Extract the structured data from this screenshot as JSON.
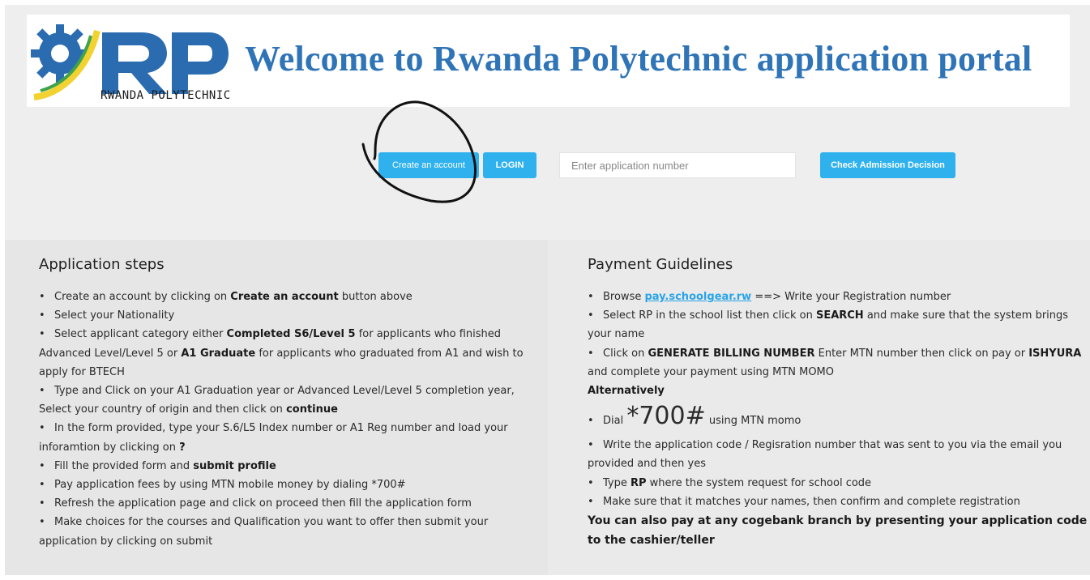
{
  "header": {
    "logo_text": "RP",
    "logo_subtitle": "RWANDA POLYTECHNIC",
    "welcome": "Welcome to Rwanda Polytechnic application portal"
  },
  "actions": {
    "create_account": "Create an account",
    "login": "LOGIN",
    "application_number_placeholder": "Enter application number",
    "check_admission": "Check Admission Decision"
  },
  "application_steps": {
    "title": "Application steps",
    "items": [
      [
        "Create an account by clicking on ",
        "Create an account",
        " button above"
      ],
      [
        "Select your Nationality"
      ],
      [
        "Select applicant category either ",
        "Completed S6/Level 5",
        " for applicants who finished Advanced Level/Level 5 or ",
        "A1 Graduate",
        " for applicants who graduated from A1 and wish to apply for BTECH"
      ],
      [
        "Type and Click on your A1 Graduation year or Advanced Level/Level 5 completion year, Select your country of origin and then click on ",
        "continue"
      ],
      [
        "In the form provided, type your S.6/L5 Index number or A1 Reg number and load your inforamtion by clicking on ",
        "?"
      ],
      [
        "Fill the provided form and ",
        "submit profile"
      ],
      [
        "Pay application fees by using MTN mobile money by dialing *700#"
      ],
      [
        "Refresh the application page and click on proceed then fill the application form"
      ],
      [
        "Make choices for the courses and Qualification you want to offer then submit your application by clicking on submit"
      ]
    ]
  },
  "payment": {
    "title": "Payment Guidelines",
    "browse_prefix": "Browse ",
    "browse_link": "pay.schoolgear.rw",
    "browse_suffix": " ==> Write your Registration number",
    "select_rp_1": "Select RP in the school list then click on ",
    "select_rp_bold": "SEARCH",
    "select_rp_2": " and make sure that the system brings your name",
    "billing_1": "Click on ",
    "billing_bold1": "GENERATE BILLING NUMBER",
    "billing_2": " Enter MTN number then click on pay or ",
    "billing_bold2": "ISHYURA",
    "billing_3": " and complete your payment using MTN MOMO",
    "alternatively": "Alternatively",
    "dial_prefix": "Dial ",
    "dial_code": "*700#",
    "dial_suffix": " using MTN momo",
    "write_code": "Write the application code / Regisration number that was sent to you via the email you provided and then yes",
    "type_1": "Type ",
    "type_bold": "RP",
    "type_2": " where the system request for school code",
    "confirm": "Make sure that it matches your names, then confirm and complete registration",
    "cogebank": "You can also pay at any cogebank branch by presenting your application code to the cashier/teller"
  }
}
